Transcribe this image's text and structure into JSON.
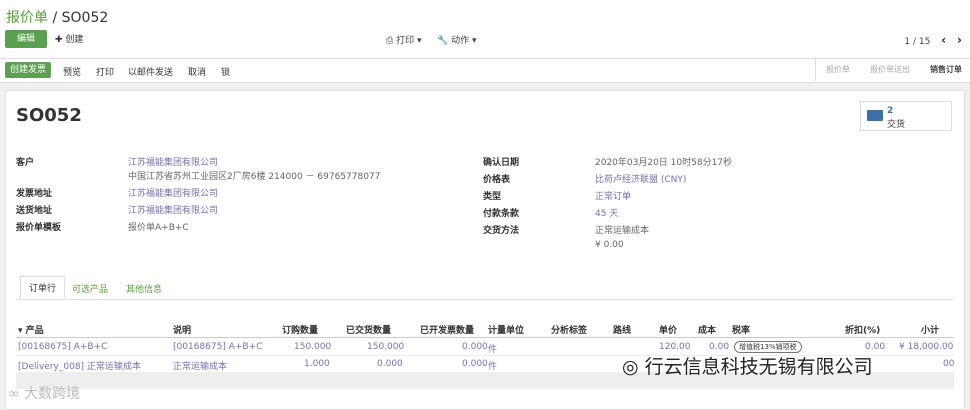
{
  "breadcrumb": {
    "parent": "报价单",
    "separator": "/",
    "current": "SO052"
  },
  "toolbar": {
    "edit": "编辑",
    "create": "✚ 创建",
    "print": "打印 ▾",
    "action": "动作 ▾",
    "pager": "1 / 15",
    "prev_icon": "‹",
    "next_icon": "›"
  },
  "actions": [
    "预览",
    "打印",
    "以邮件发送",
    "取消",
    "锁"
  ],
  "invoice_button": "创建发票",
  "stages": [
    "报价单",
    "报价单送出",
    "销售订单"
  ],
  "record": {
    "name": "SO052"
  },
  "smart_button": {
    "count": "2",
    "label": "交货"
  },
  "left_fields": [
    {
      "label": "客户",
      "value": "江苏福能集团有限公司",
      "extra": "中国江苏省苏州工业园区2厂房6楼 214000 － 69765778077"
    },
    {
      "label": "发票地址",
      "value": "江苏福能集团有限公司"
    },
    {
      "label": "送货地址",
      "value": "江苏福能集团有限公司"
    },
    {
      "label": "报价单模板",
      "value": "报价单A+B+C"
    }
  ],
  "right_fields": [
    {
      "label": "确认日期",
      "value": "2020年03月20日 10时58分17秒"
    },
    {
      "label": "价格表",
      "value": "比荷卢经济联盟 (CNY)"
    },
    {
      "label": "类型",
      "value": "正常订单"
    },
    {
      "label": "付款条款",
      "value": "45 天"
    },
    {
      "label": "交货方法",
      "value": "正常运输成本"
    },
    {
      "label": "",
      "value": "¥ 0.00"
    }
  ],
  "tabs": [
    "订单行",
    "可选产品",
    "其他信息"
  ],
  "table": {
    "headers": [
      "▾ 产品",
      "说明",
      "订购数量",
      "已交货数量",
      "已开发票数量",
      "计量单位",
      "分析标签",
      "路线",
      "单价",
      "成本",
      "税率",
      "折扣(%)",
      "小计"
    ],
    "rows": [
      {
        "product": "[00168675] A+B+C",
        "desc": "[00168675] A+B+C",
        "qty": "150.000",
        "delivered": "150.000",
        "invoiced": "0.000",
        "uom": "件",
        "price": "120.00",
        "cost": "0.00",
        "tax": "增值税13%销项税",
        "discount": "0.00",
        "subtotal": "¥ 18,000.00"
      },
      {
        "product": "[Delivery_008] 正常运输成本",
        "desc": "正常运输成本",
        "qty": "1.000",
        "delivered": "0.000",
        "invoiced": "0.000",
        "uom": "件",
        "price": "",
        "cost": "",
        "tax": "",
        "discount": "",
        "subtotal": "00"
      }
    ]
  },
  "watermark": {
    "text": "行云信息科技无锡有限公司",
    "left_text": "大数跨境"
  }
}
